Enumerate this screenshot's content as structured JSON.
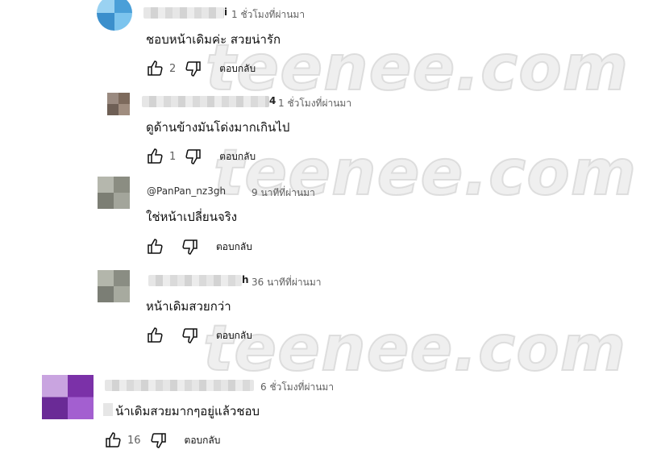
{
  "comments": [
    {
      "name_tail": "i",
      "time": "1 ชั่วโมงที่ผ่านมา",
      "text": "ชอบหน้าเดิมค่ะ สวยน่ารัก",
      "likes": "2",
      "reply_label": "ตอบกลับ",
      "avatar_color": "#5aaee0"
    },
    {
      "name_tail": "4",
      "time": "1 ชั่วโมงที่ผ่านมา",
      "text": "ดูด้านข้างมันโด่งมากเกินไป",
      "likes": "1",
      "reply_label": "ตอบกลับ",
      "avatar_color": "#8a7a6e"
    },
    {
      "name_tail": "@PanPan_nz3gh",
      "time": "9 นาทีที่ผ่านมา",
      "text": "ใช่หน้าเปลี่ยนจริง",
      "likes": "",
      "reply_label": "ตอบกลับ",
      "avatar_color": "#8e9085"
    },
    {
      "name_tail": "h",
      "time": "36 นาทีที่ผ่านมา",
      "text": "หน้าเดิมสวยกว่า",
      "likes": "",
      "reply_label": "ตอบกลับ",
      "avatar_color": "#8d9185"
    },
    {
      "name_tail": "",
      "time": "6 ชั่วโมงที่ผ่านมา",
      "text": "น้าเดิมสวยมากๆอยู่แล้วชอบ",
      "likes": "16",
      "reply_label": "ตอบกลับ",
      "avatar_color": "#8a3fb5"
    }
  ],
  "watermark": "teenee.com",
  "icons": {
    "like": "thumbs-up-icon",
    "dislike": "thumbs-down-icon"
  }
}
